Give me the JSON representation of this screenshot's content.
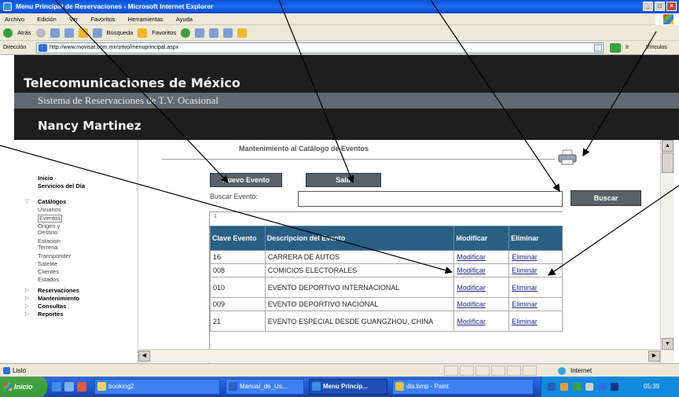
{
  "window": {
    "title": "Menu Principal de Reservaciones - Microsoft Internet Explorer"
  },
  "menubar": [
    "Archivo",
    "Edición",
    "Ver",
    "Favoritos",
    "Herramientas",
    "Ayuda"
  ],
  "toolbar": {
    "back": "Atrás",
    "search": "Búsqueda",
    "favorites": "Favoritos"
  },
  "address": {
    "label": "Dirección",
    "url": "http://www.movisat.com.mx/srtvo/menuprincipal.aspx",
    "go": "Ir",
    "links": "Vínculos"
  },
  "banner": {
    "company": "Telecomunicaciones de México",
    "system": "Sistema de Reservaciones de T.V. Ocasional",
    "user": "Nancy Martinez"
  },
  "sidebar": {
    "items": [
      {
        "label": "Inicio",
        "bold": true
      },
      {
        "label": "Servicios del Día",
        "bold": true
      },
      {
        "label": "Catálogos",
        "bold": true
      },
      {
        "label": "Usuarios",
        "bold": false
      },
      {
        "label": "Eventos",
        "bold": false
      },
      {
        "label": "Origen y Destino",
        "bold": false
      },
      {
        "label": "Estacion Terrena",
        "bold": false
      },
      {
        "label": "Transponder",
        "bold": false
      },
      {
        "label": "Satelite",
        "bold": false
      },
      {
        "label": "Clientes",
        "bold": false
      },
      {
        "label": "Estados",
        "bold": false
      },
      {
        "label": "Reservaciones",
        "bold": true
      },
      {
        "label": "Mantenimiento",
        "bold": true
      },
      {
        "label": "Consultas",
        "bold": true
      },
      {
        "label": "Reportes",
        "bold": true
      }
    ]
  },
  "main": {
    "title": "Mantenimiento al Catálogo de Eventos",
    "new_button": "Nuevo Evento",
    "exit_button": "Salir",
    "search_label": "Buscar Evento:",
    "search_value": "",
    "search_button": "Buscar",
    "grid_page": "1",
    "table": {
      "headers": [
        "Clave Evento",
        "Descripcion del Evento",
        "Modificar",
        "Eliminar"
      ],
      "rows": [
        {
          "clave": "16",
          "desc": "CARRERA DE AUTOS",
          "mod": "Modificar",
          "del": "Eliminar"
        },
        {
          "clave": "008",
          "desc": "COMICIOS ELECTORALES",
          "mod": "Modificar",
          "del": "Eliminar"
        },
        {
          "clave": "010",
          "desc": "EVENTO DEPORTIVO INTERNACIONAL",
          "mod": "Modificar",
          "del": "Eliminar"
        },
        {
          "clave": "009",
          "desc": "EVENTO DEPORTIVO NACIONAL",
          "mod": "Modificar",
          "del": "Eliminar"
        },
        {
          "clave": "21",
          "desc": "EVENTO ESPECIAL DESDE GUANGZHOU, CHINA",
          "mod": "Modificar",
          "del": "Eliminar"
        }
      ]
    }
  },
  "statusbar": {
    "status": "Listo",
    "zone": "Internet"
  },
  "taskbar": {
    "start": "Inicio",
    "tasks": [
      "booking2",
      "Manual_de_Us...",
      "Menu Princip...",
      "dia.bmp - Paint"
    ],
    "clock": "05:39 p.m."
  }
}
